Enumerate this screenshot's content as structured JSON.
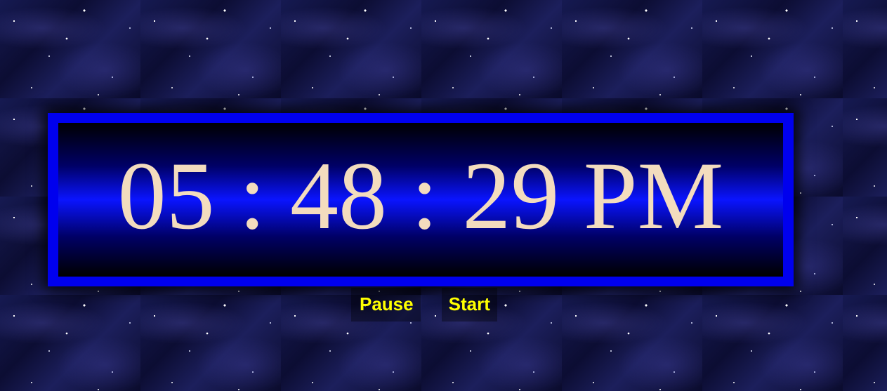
{
  "clock": {
    "hours": "05",
    "minutes": "48",
    "seconds": "29",
    "separator": ":",
    "period": "PM",
    "display": "05 : 48 : 29 PM"
  },
  "controls": {
    "pause_label": "Pause",
    "start_label": "Start"
  },
  "colors": {
    "frame": "#0000ee",
    "digits": "#f3dcbe",
    "button_text": "#ffff00",
    "background": "#0e0f3a"
  }
}
